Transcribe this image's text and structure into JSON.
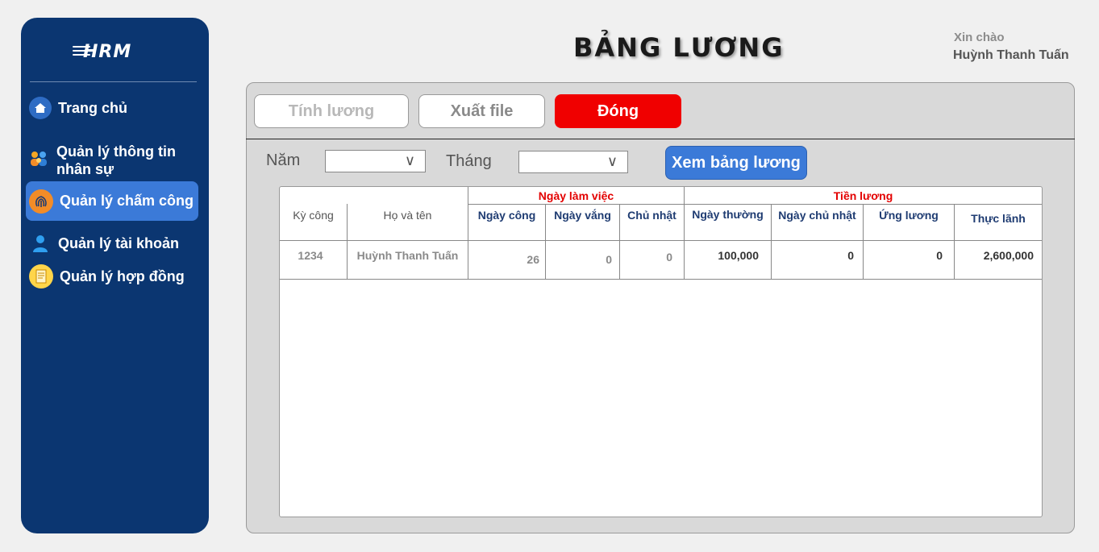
{
  "app": {
    "logo_text": "HRM",
    "title": "BẢNG LƯƠNG",
    "greeting": "Xin chào",
    "user_name": "Huỳnh Thanh Tuấn"
  },
  "sidebar": {
    "items": [
      {
        "label": "Trang chủ",
        "icon": "home-icon"
      },
      {
        "label": "Quản lý thông tin",
        "label2": "nhân sự",
        "icon": "people-icon"
      },
      {
        "label": "Quản lý chấm công",
        "icon": "fingerprint-icon",
        "active": true
      },
      {
        "label": "Quản lý tài khoản",
        "icon": "user-icon"
      },
      {
        "label": "Quản lý hợp đồng",
        "icon": "contract-icon"
      }
    ]
  },
  "toolbar": {
    "tinh_luong": "Tính lương",
    "xuat_file": "Xuất file",
    "dong": "Đóng"
  },
  "filters": {
    "year_label": "Năm",
    "year_value": "",
    "month_label": "Tháng",
    "month_value": "",
    "view_button": "Xem bảng lương"
  },
  "table": {
    "group_headers": {
      "ngay_lam_viec": "Ngày làm việc",
      "tien_luong": "Tiền lương"
    },
    "columns": [
      "Kỳ công",
      "Họ và tên",
      "Ngày công",
      "Ngày vắng",
      "Chủ nhật",
      "Ngày thường",
      "Ngày chủ nhật",
      "Ứng lương",
      "Thực lãnh"
    ],
    "rows": [
      [
        "1234",
        "Huỳnh Thanh Tuấn",
        "26",
        "0",
        "0",
        "100,000",
        "0",
        "0",
        "2,600,000"
      ]
    ]
  },
  "colors": {
    "sidebar_bg": "#0b3671",
    "accent": "#3b7ad8",
    "danger": "#f00000"
  }
}
